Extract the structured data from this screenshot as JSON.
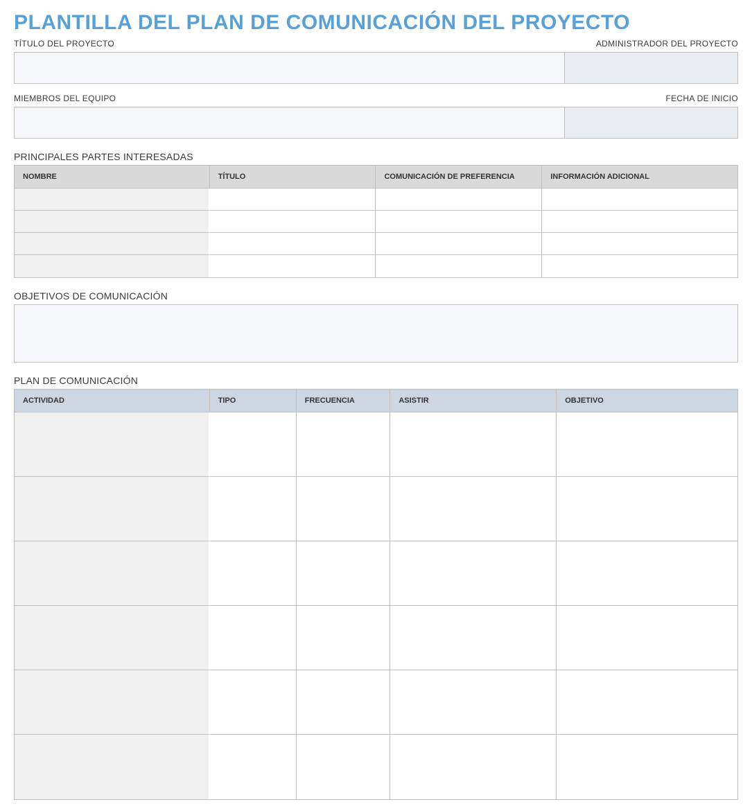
{
  "page_title": "PLANTILLA DEL  PLAN DE COMUNICACIÓN DEL PROYECTO",
  "header": {
    "project_title_label": "TÍTULO DEL PROYECTO",
    "project_title_value": "",
    "admin_label": "ADMINISTRADOR DEL PROYECTO",
    "admin_value": "",
    "team_label": "MIEMBROS DEL EQUIPO",
    "team_value": "",
    "start_date_label": "FECHA DE INICIO",
    "start_date_value": ""
  },
  "stakeholders": {
    "section_title": "PRINCIPALES PARTES INTERESADAS",
    "columns": {
      "nombre": "NOMBRE",
      "titulo": "TÍTULO",
      "pref": "COMUNICACIÓN DE PREFERENCIA",
      "info": "INFORMACIÓN ADICIONAL"
    },
    "rows": [
      {
        "nombre": "",
        "titulo": "",
        "pref": "",
        "info": ""
      },
      {
        "nombre": "",
        "titulo": "",
        "pref": "",
        "info": ""
      },
      {
        "nombre": "",
        "titulo": "",
        "pref": "",
        "info": ""
      },
      {
        "nombre": "",
        "titulo": "",
        "pref": "",
        "info": ""
      }
    ]
  },
  "objectives": {
    "section_title": "OBJETIVOS DE COMUNICACIÓN",
    "value": ""
  },
  "plan": {
    "section_title": "PLAN DE COMUNICACIÓN",
    "columns": {
      "actividad": "ACTIVIDAD",
      "tipo": "TIPO",
      "frecuencia": "FRECUENCIA",
      "asistir": "ASISTIR",
      "objetivo": "OBJETIVO"
    },
    "rows": [
      {
        "actividad": "",
        "tipo": "",
        "frecuencia": "",
        "asistir": "",
        "objetivo": ""
      },
      {
        "actividad": "",
        "tipo": "",
        "frecuencia": "",
        "asistir": "",
        "objetivo": ""
      },
      {
        "actividad": "",
        "tipo": "",
        "frecuencia": "",
        "asistir": "",
        "objetivo": ""
      },
      {
        "actividad": "",
        "tipo": "",
        "frecuencia": "",
        "asistir": "",
        "objetivo": ""
      },
      {
        "actividad": "",
        "tipo": "",
        "frecuencia": "",
        "asistir": "",
        "objetivo": ""
      },
      {
        "actividad": "",
        "tipo": "",
        "frecuencia": "",
        "asistir": "",
        "objetivo": ""
      }
    ]
  }
}
